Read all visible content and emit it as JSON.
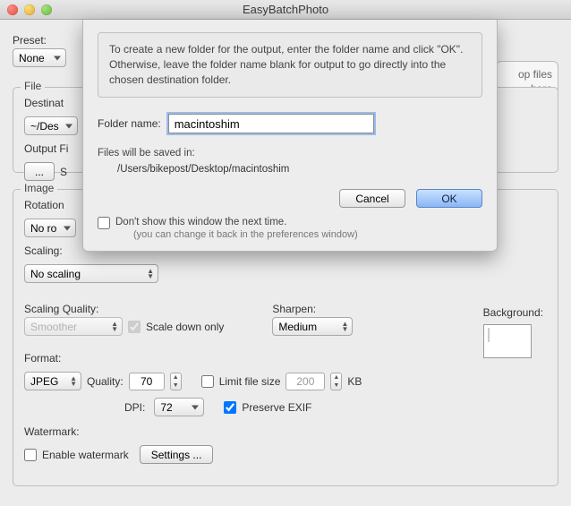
{
  "window": {
    "title": "EasyBatchPhoto"
  },
  "dropzone": {
    "line1": "op files",
    "line2": "here"
  },
  "preset": {
    "label": "Preset:",
    "value": "None"
  },
  "file": {
    "legend": "File",
    "destination_label": "Destinat",
    "destination_value": "~/Des",
    "output_label": "Output Fi",
    "save_label": "S"
  },
  "image": {
    "legend": "Image",
    "rotation_label": "Rotation",
    "rotation_value": "No ro",
    "scaling_label": "Scaling:",
    "scaling_value": "No scaling",
    "scaling_quality_label": "Scaling Quality:",
    "scaling_quality_value": "Smoother",
    "scale_down_only": "Scale down only",
    "sharpen_label": "Sharpen:",
    "sharpen_value": "Medium",
    "format_label": "Format:",
    "format_value": "JPEG",
    "quality_label": "Quality:",
    "quality_value": "70",
    "limit_label": "Limit file size",
    "limit_value": "200",
    "limit_unit": "KB",
    "dpi_label": "DPI:",
    "dpi_value": "72",
    "preserve_exif": "Preserve EXIF",
    "background_label": "Background:",
    "watermark_label": "Watermark:",
    "enable_watermark": "Enable watermark",
    "settings_btn": "Settings ..."
  },
  "sheet": {
    "info": "To create a new folder for the output, enter the folder name and click \"OK\".  Otherwise, leave the folder name blank for output to go directly into the chosen destination folder.",
    "folder_label": "Folder name:",
    "folder_value": "macintoshim",
    "saved_label": "Files will be saved in:",
    "saved_path": "/Users/bikepost/Desktop/macintoshim",
    "cancel": "Cancel",
    "ok": "OK",
    "dont_show": "Don't show this window the next time.",
    "dont_sub": "(you can change it back in the preferences window)"
  }
}
